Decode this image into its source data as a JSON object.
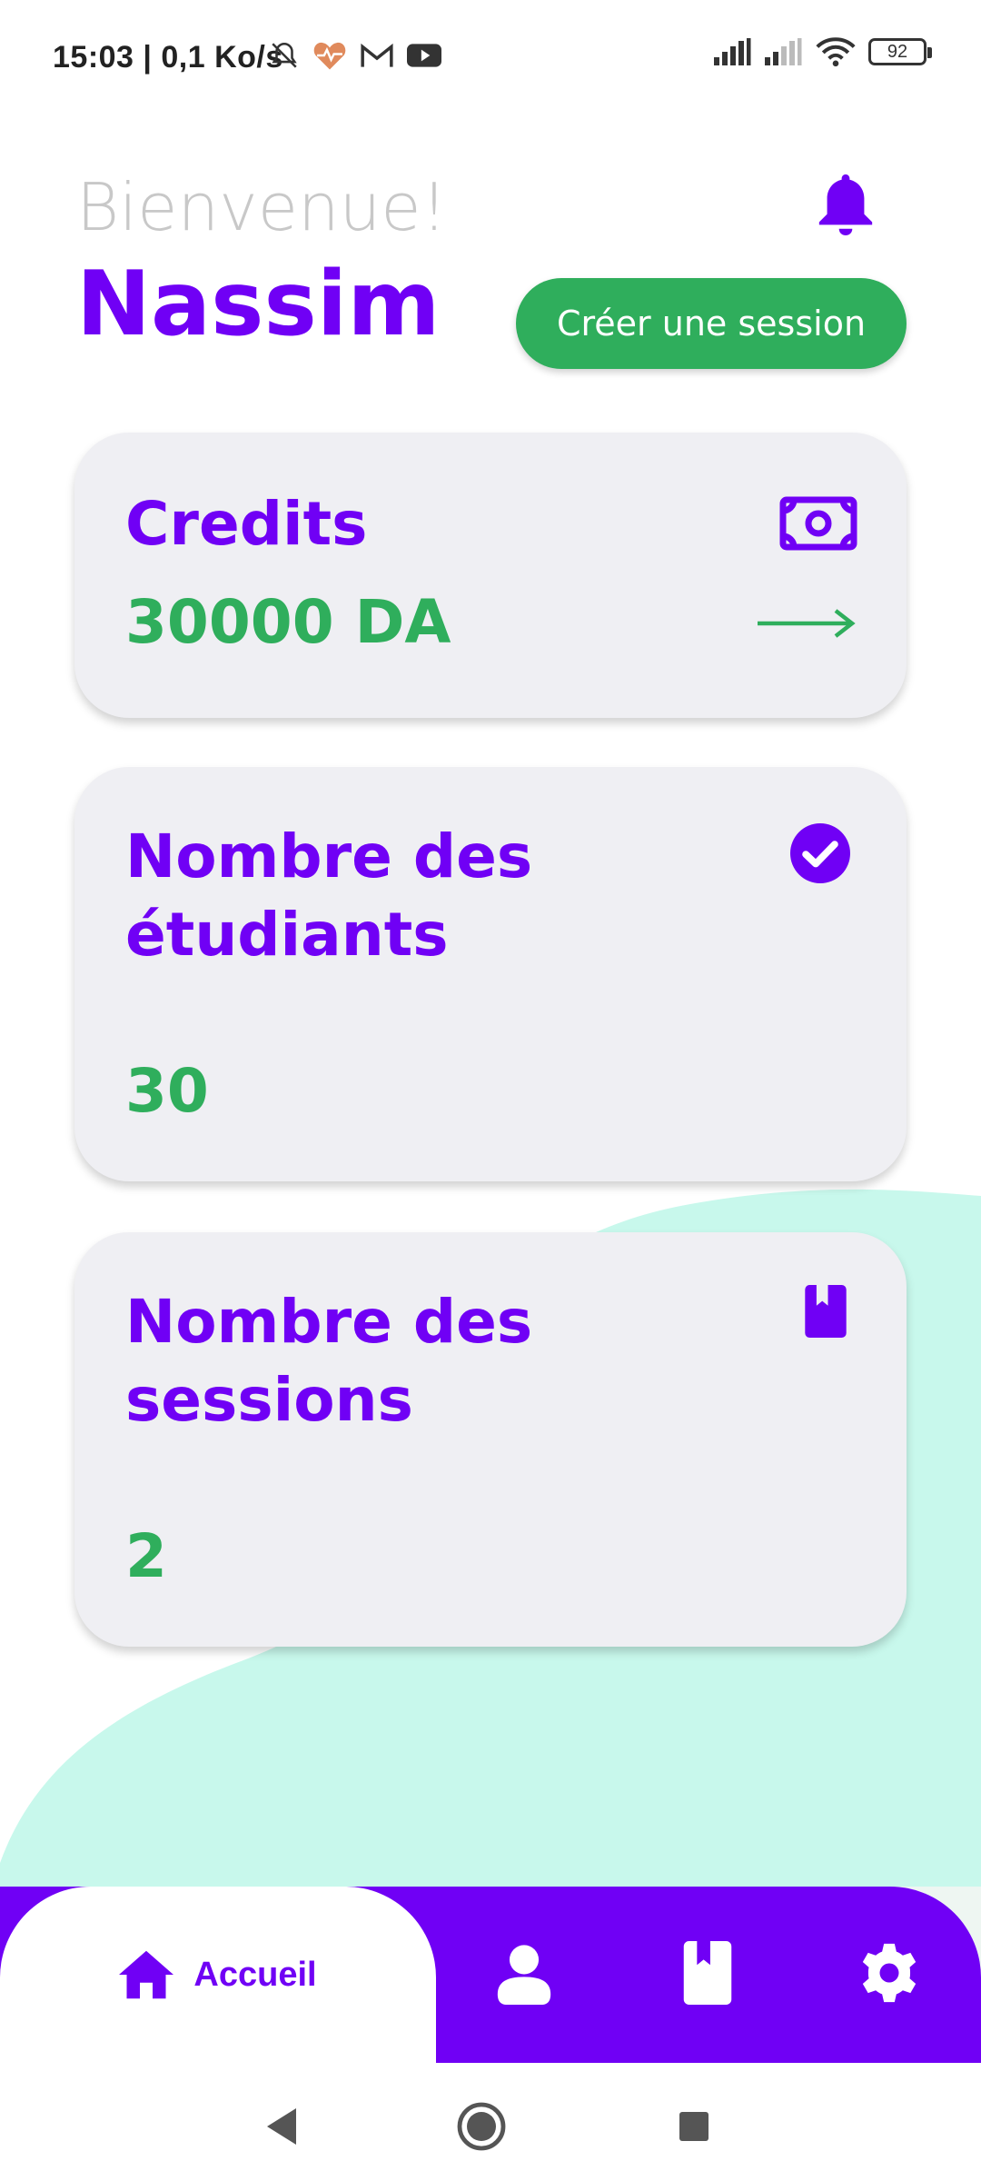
{
  "status_bar": {
    "time": "15:03 | 0,1 Ko/s",
    "battery": "92",
    "icons": [
      "bell-off-icon",
      "heart-rate-icon",
      "gmail-icon",
      "youtube-icon",
      "signal-icon",
      "signal-icon",
      "wifi-icon",
      "battery-icon"
    ]
  },
  "header": {
    "greeting": "Bienvenue!",
    "username": "Nassim",
    "create_session_label": "Créer une session"
  },
  "cards": {
    "credits": {
      "title": "Credits",
      "value": "30000 DA",
      "icon": "banknote-icon"
    },
    "students": {
      "title_line1": "Nombre des",
      "title_line2": "étudiants",
      "value": "30",
      "icon": "check-circle-icon"
    },
    "sessions": {
      "title_line1": "Nombre des",
      "title_line2": "sessions",
      "value": "2",
      "icon": "book-icon"
    }
  },
  "bottom_nav": {
    "items": [
      {
        "label": "Accueil",
        "icon": "home-icon",
        "active": true
      },
      {
        "label": "",
        "icon": "person-icon"
      },
      {
        "label": "",
        "icon": "book-icon"
      },
      {
        "label": "",
        "icon": "gear-icon"
      }
    ]
  },
  "colors": {
    "primary": "#7000f5",
    "success": "#2fae5c",
    "card_bg": "#efeff3",
    "wave": "#c8f8ec"
  }
}
